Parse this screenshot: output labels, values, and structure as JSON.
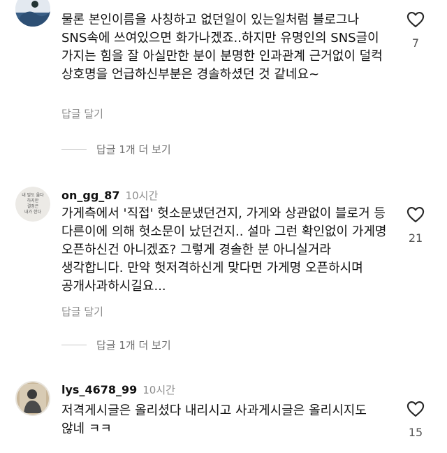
{
  "comments": [
    {
      "username": "",
      "time": "",
      "text": "물론 본인이름을 사칭하고 없던일이 있는일처럼 블로그나 SNS속에 쓰여있으면 화가나겠죠..하지만 유명인의 SNS글이 가지는 힘을 잘 아실만한 분이 분명한 인과관계 근거없이 덜컥 상호명을 언급하신부분은 경솔하셨던 것 같네요~",
      "reply_label": "답글 달기",
      "more_replies_label": "답글 1개 더 보기",
      "likes": "7"
    },
    {
      "username": "on_gg_87",
      "time": "10시간",
      "text": "가게측에서 '직접' 헛소문냈던건지, 가게와 상관없이 블로거 등 다른이에 의해 헛소문이 났던건지.. 설마 그런 확인없이 가게명 오픈하신건 아니겠죠? 그렇게 경솔한 분 아니실거라 생각합니다. 만약 헛저격하신게 맞다면 가게명 오픈하시며 공개사과하시길요...",
      "reply_label": "답글 달기",
      "more_replies_label": "답글 1개 더 보기",
      "likes": "21",
      "avatar_text": "내 말도 옳다 하지만 결정은 내가 한다"
    },
    {
      "username": "lys_4678_99",
      "time": "10시간",
      "text": "저격게시글은 올리셨다 내리시고 사과게시글은 올리시지도 않네 ㅋㅋ",
      "likes": "15"
    }
  ],
  "icons": {
    "like": "heart-outline-icon"
  },
  "colors": {
    "secondary_text": "#8e8e8e",
    "primary_text": "#111111",
    "divider": "#c7c7c7"
  }
}
